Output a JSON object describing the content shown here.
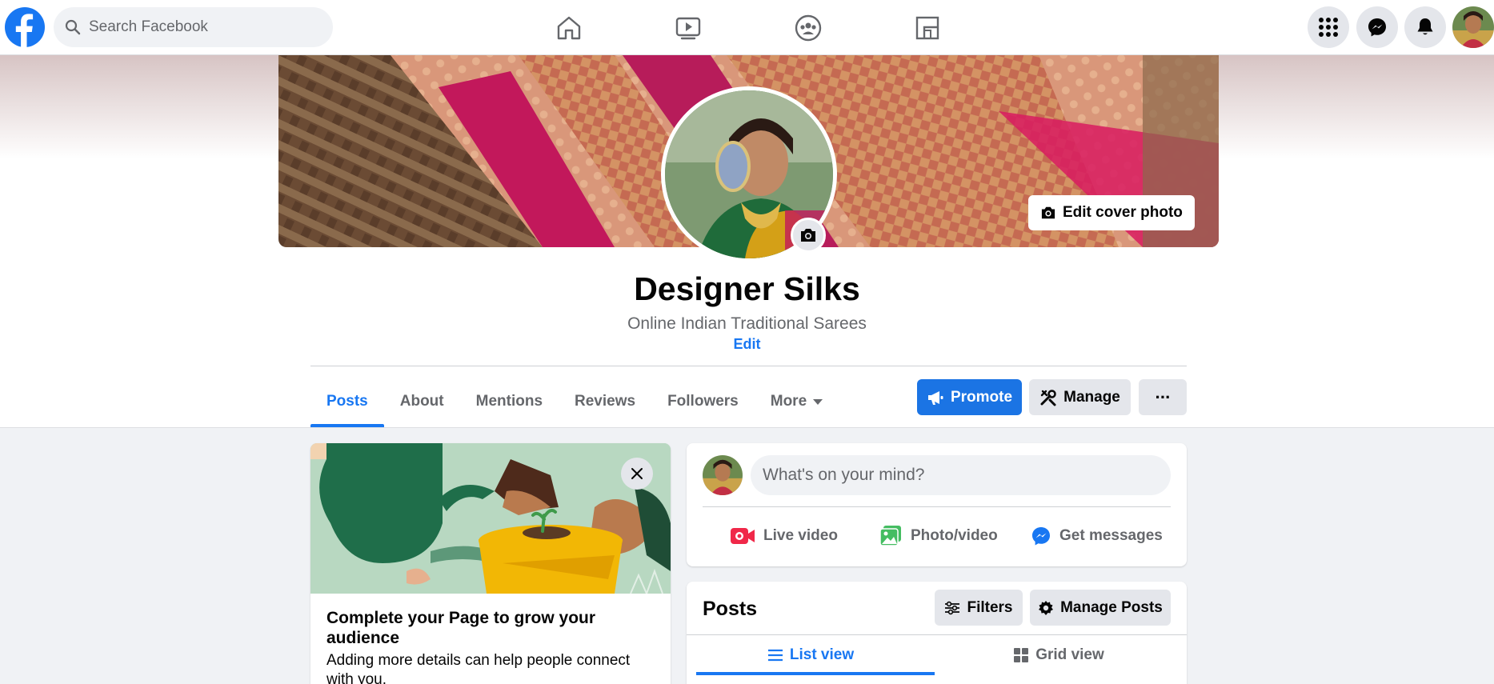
{
  "topbar": {
    "search_placeholder": "Search Facebook",
    "nav_icons": [
      "home-icon",
      "watch-icon",
      "groups-icon",
      "pages-icon"
    ],
    "right_icons": [
      "menu-grid-icon",
      "messenger-icon",
      "notifications-icon"
    ]
  },
  "profile": {
    "name": "Designer Silks",
    "category": "Online Indian Traditional Sarees",
    "edit_label": "Edit",
    "edit_cover_label": "Edit cover photo"
  },
  "tabs": [
    {
      "label": "Posts",
      "active": true
    },
    {
      "label": "About"
    },
    {
      "label": "Mentions"
    },
    {
      "label": "Reviews"
    },
    {
      "label": "Followers"
    },
    {
      "label": "More"
    }
  ],
  "actions": {
    "promote": "Promote",
    "manage": "Manage",
    "more": "···"
  },
  "left_card": {
    "title": "Complete your Page to grow your audience",
    "description": "Adding more details can help people connect with you."
  },
  "composer": {
    "placeholder": "What's on your mind?",
    "live_video": "Live video",
    "photo_video": "Photo/video",
    "get_messages": "Get messages"
  },
  "posts": {
    "title": "Posts",
    "filters": "Filters",
    "manage_posts": "Manage Posts",
    "list_view": "List view",
    "grid_view": "Grid view"
  },
  "colors": {
    "brand_blue": "#1877f2",
    "background": "#f0f2f5",
    "button_gray": "#e4e6eb"
  }
}
